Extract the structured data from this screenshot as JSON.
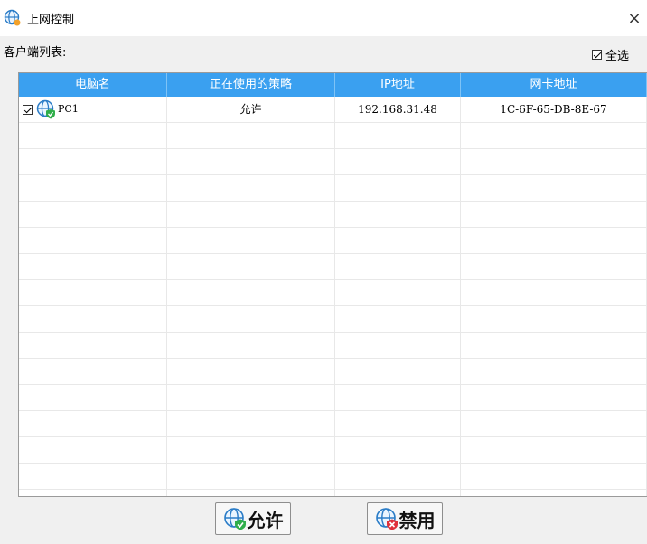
{
  "window": {
    "title": "上网控制",
    "close_glyph": "×"
  },
  "client_list": {
    "label": "客户端列表:",
    "select_all_label": "全选",
    "select_all_checked": true,
    "columns": [
      "电脑名",
      "正在使用的策略",
      "IP地址",
      "网卡地址"
    ],
    "rows": [
      {
        "checked": true,
        "computer_name": "PC1",
        "policy": "允许",
        "ip": "192.168.31.48",
        "mac": "1C-6F-65-DB-8E-67"
      }
    ]
  },
  "buttons": {
    "allow_label": "允许",
    "deny_label": "禁用"
  },
  "icons": {
    "app": "globe-icon",
    "pc": "globe-shield-check-icon",
    "allow": "globe-check-icon",
    "deny": "globe-deny-icon"
  },
  "colors": {
    "header_bg": "#3aa0f0",
    "header_text": "#ffffff",
    "shield_green": "#2fae4a",
    "deny_red": "#e0303a"
  }
}
